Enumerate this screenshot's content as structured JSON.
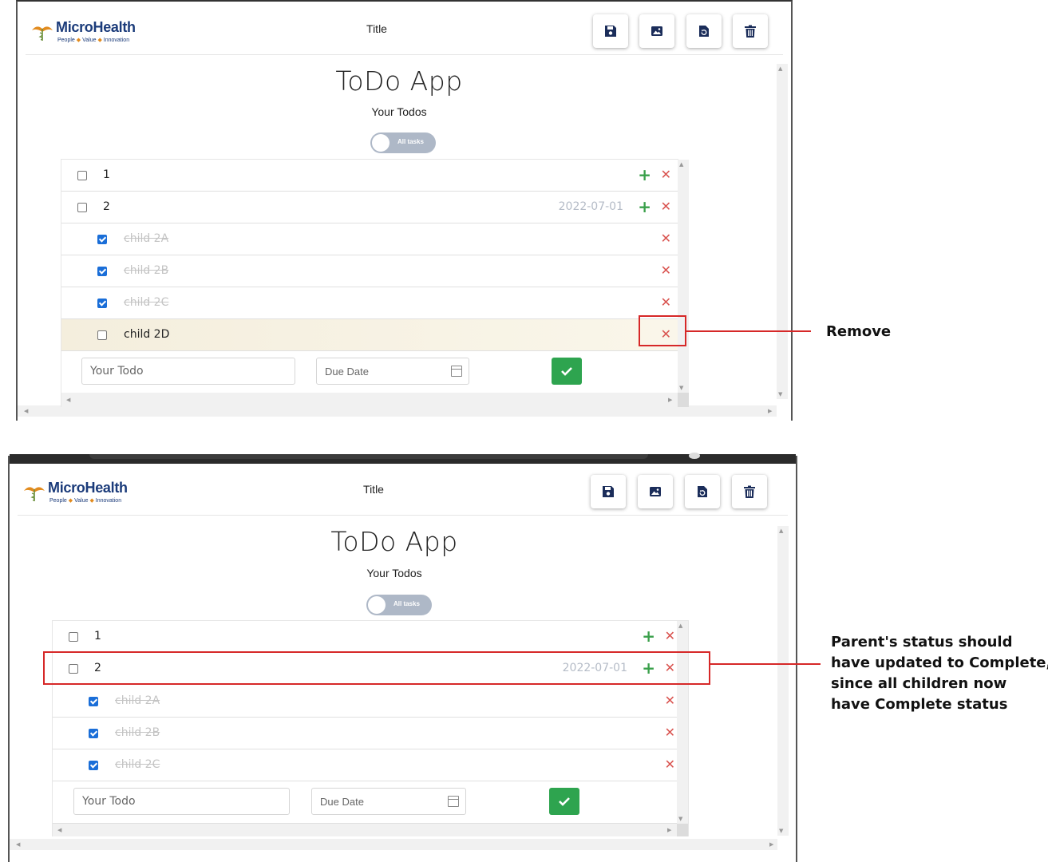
{
  "brand": {
    "name": "MicroHealth",
    "tagline_1": "People",
    "tagline_2": "Value",
    "tagline_3": "Innovation",
    "sep": "◆"
  },
  "header": {
    "title": "Title"
  },
  "toolbar": {
    "save_icon": "save-icon",
    "image_icon": "image-icon",
    "restore_icon": "restore-icon",
    "delete_icon": "trash-icon"
  },
  "app": {
    "title": "ToDo App",
    "subtitle": "Your Todos",
    "toggle_label": "All tasks"
  },
  "before": {
    "rows": [
      {
        "text": "1",
        "checked": false,
        "date": "",
        "has_add": true
      },
      {
        "text": "2",
        "checked": false,
        "date": "2022-07-01",
        "has_add": true
      },
      {
        "text": "child 2A",
        "checked": true,
        "date": "",
        "has_add": false
      },
      {
        "text": "child 2B",
        "checked": true,
        "date": "",
        "has_add": false
      },
      {
        "text": "child 2C",
        "checked": true,
        "date": "",
        "has_add": false
      },
      {
        "text": "child 2D",
        "checked": false,
        "date": "",
        "has_add": false
      }
    ]
  },
  "after": {
    "rows": [
      {
        "text": "1",
        "checked": false,
        "date": "",
        "has_add": true
      },
      {
        "text": "2",
        "checked": false,
        "date": "2022-07-01",
        "has_add": true
      },
      {
        "text": "child 2A",
        "checked": true,
        "date": "",
        "has_add": false
      },
      {
        "text": "child 2B",
        "checked": true,
        "date": "",
        "has_add": false
      },
      {
        "text": "child 2C",
        "checked": true,
        "date": "",
        "has_add": false
      }
    ]
  },
  "form": {
    "todo_placeholder": "Your Todo",
    "date_placeholder": "Due Date"
  },
  "glyphs": {
    "add": "+",
    "remove": "✕",
    "up": "▲",
    "down": "▼",
    "left": "◀",
    "right": "▶"
  },
  "annotations": {
    "remove": "Remove",
    "parent_1": "Parent's status should",
    "parent_2": "have updated to Complete,",
    "parent_3": "since all children now",
    "parent_4": "have Complete status"
  },
  "colors": {
    "navy": "#1b3b7a",
    "green": "#2ea44f",
    "red": "#d9534f",
    "annotation": "#d62828",
    "toggle": "#aeb8c7"
  }
}
